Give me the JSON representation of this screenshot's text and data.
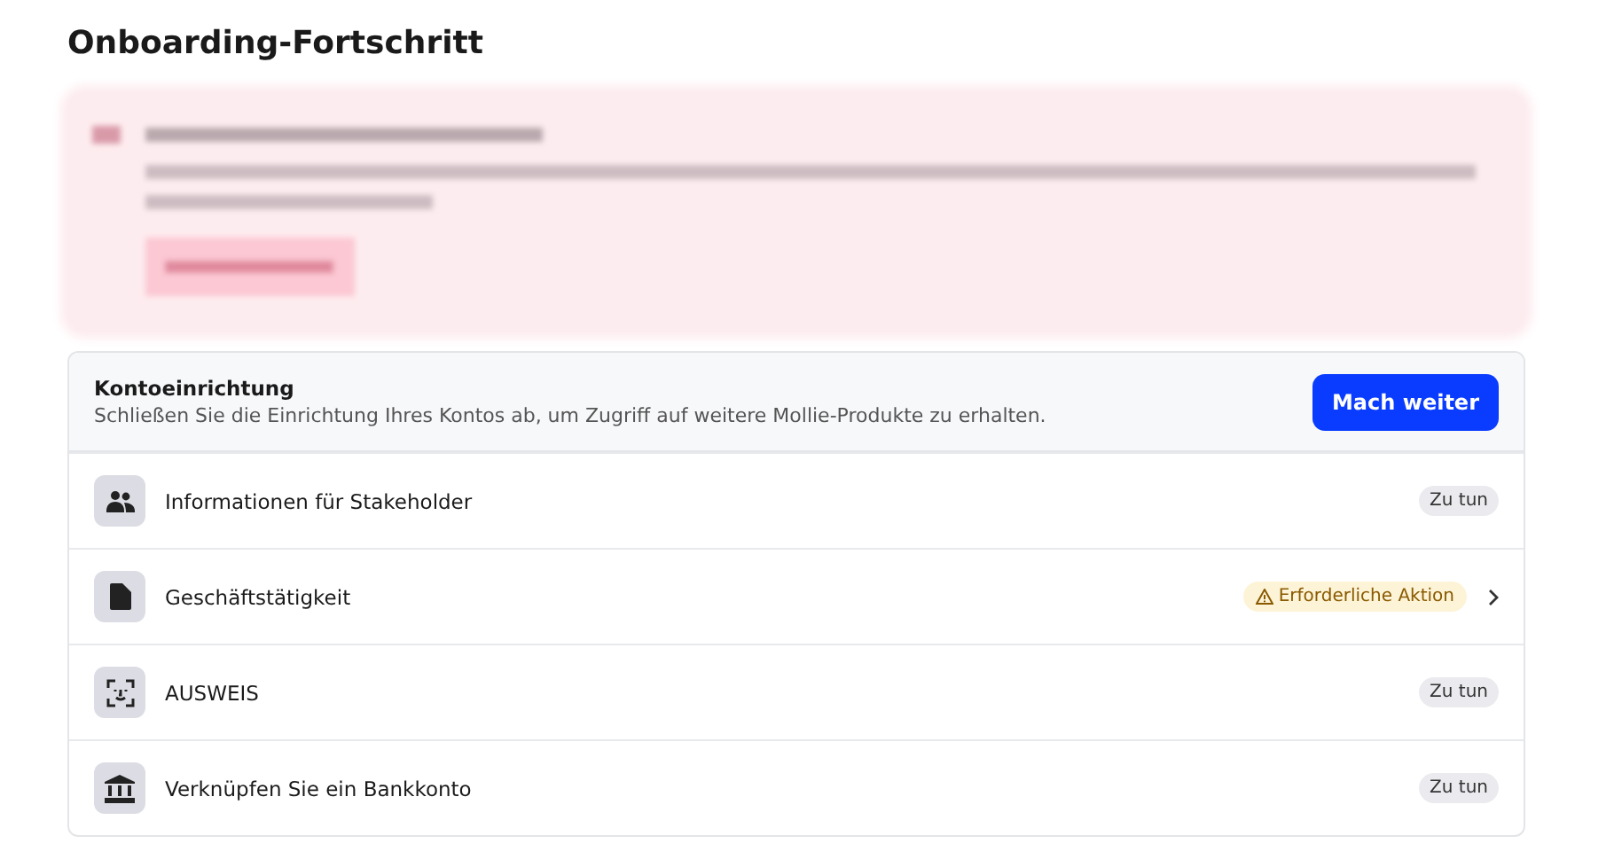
{
  "title": "Onboarding-Fortschritt",
  "alert": {
    "kind": "redacted"
  },
  "card": {
    "heading": "Kontoeinrichtung",
    "description": "Schließen Sie die Einrichtung Ihres Kontos ab, um Zugriff auf weitere Mollie-Produkte zu erhalten.",
    "button": "Mach weiter"
  },
  "steps": [
    {
      "kind": "people",
      "label": "Informationen für Stakeholder",
      "status": {
        "kind": "todo",
        "text": "Zu tun"
      },
      "chevron": false
    },
    {
      "kind": "document",
      "label": "Geschäftstätigkeit",
      "status": {
        "kind": "action",
        "text": "Erforderliche Aktion"
      },
      "chevron": true
    },
    {
      "kind": "face",
      "label": "AUSWEIS",
      "status": {
        "kind": "todo",
        "text": "Zu tun"
      },
      "chevron": false
    },
    {
      "kind": "bank",
      "label": "Verknüpfen Sie ein Bankkonto",
      "status": {
        "kind": "todo",
        "text": "Zu tun"
      },
      "chevron": false
    }
  ]
}
